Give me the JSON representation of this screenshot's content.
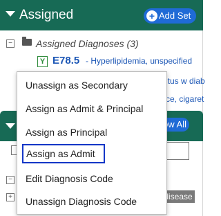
{
  "header": {
    "title": "Assigned",
    "add_set_label": "+Add Set"
  },
  "tree": {
    "group_label": "Assigned Diagnoses (3)",
    "diagnosis": {
      "badge": "Y",
      "code": "E78.5",
      "description": "- Hyperlipidemia, unspecified"
    },
    "partial_text_1": "itus w diab",
    "partial_text_2": "ce, cigaret"
  },
  "sub_panel": {
    "show_all_label": "ow All",
    "badge": "disease"
  },
  "context_menu": {
    "items": [
      "Unassign as Secondary",
      "Assign as Admit & Principal",
      "Assign as Principal",
      "Assign as Admit",
      "Edit Diagnosis Code",
      "Unassign Diagnosis Code"
    ],
    "highlighted_item": "Assign as Admit"
  },
  "colors": {
    "header_bg": "#176a55",
    "button_blue": "#1f6bd6",
    "link_blue": "#1b56b5",
    "highlight_border": "#1436c7"
  }
}
